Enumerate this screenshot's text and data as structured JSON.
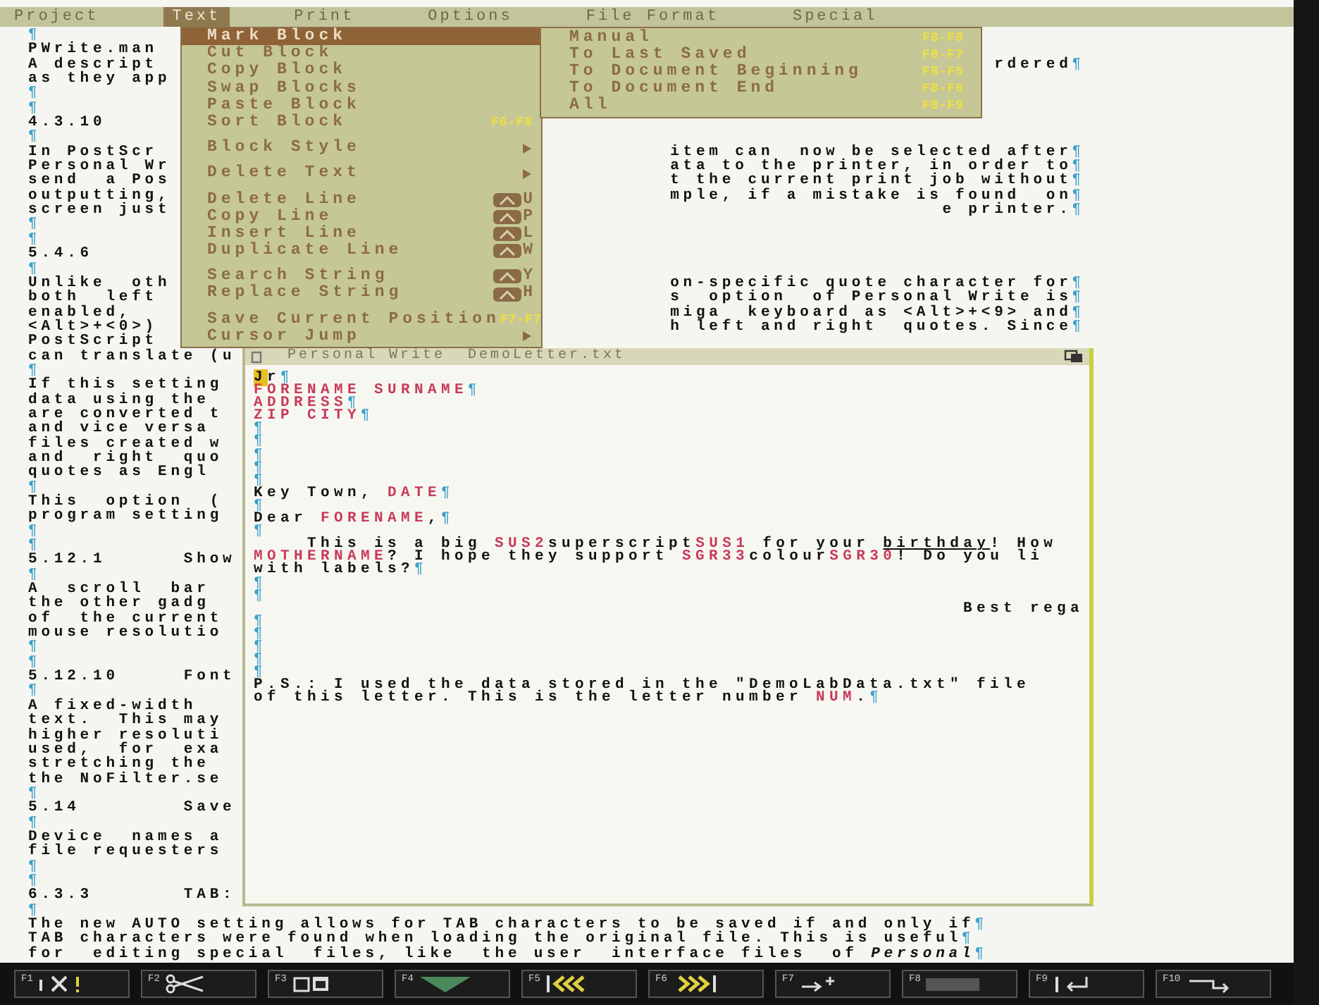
{
  "menubar": [
    {
      "label": "Project",
      "selected": false
    },
    {
      "label": "Text",
      "selected": true
    },
    {
      "label": "Print",
      "selected": false
    },
    {
      "label": "Options",
      "selected": false
    },
    {
      "label": "File Format",
      "selected": false
    },
    {
      "label": "Special",
      "selected": false
    }
  ],
  "document": {
    "lines": [
      {
        "left": [
          {
            "kind": "mark",
            "text": "¶"
          }
        ]
      },
      {
        "left": [
          {
            "kind": "plain",
            "text": "PWrite.man"
          }
        ]
      },
      {
        "left": [
          {
            "kind": "plain",
            "text": "A descript"
          }
        ],
        "right": [
          {
            "kind": "plain",
            "text": "rdered"
          },
          {
            "kind": "mark",
            "text": "¶"
          }
        ]
      },
      {
        "left": [
          {
            "kind": "plain",
            "text": "as they app"
          }
        ]
      },
      {
        "left": [
          {
            "kind": "mark",
            "text": "¶"
          }
        ]
      },
      {
        "left": [
          {
            "kind": "mark",
            "text": "¶"
          }
        ]
      },
      {
        "left": [
          {
            "kind": "plain",
            "text": "4.3.10"
          }
        ]
      },
      {
        "left": [
          {
            "kind": "mark",
            "text": "¶"
          }
        ]
      },
      {
        "left": [
          {
            "kind": "plain",
            "text": "In PostScr"
          }
        ],
        "right": [
          {
            "kind": "plain",
            "text": "item can  now be selected after"
          },
          {
            "kind": "mark",
            "text": "¶"
          }
        ]
      },
      {
        "left": [
          {
            "kind": "plain",
            "text": "Personal Wr"
          }
        ],
        "right": [
          {
            "kind": "plain",
            "text": "ata to the printer, in order to"
          },
          {
            "kind": "mark",
            "text": "¶"
          }
        ]
      },
      {
        "left": [
          {
            "kind": "plain",
            "text": "send  a Pos"
          }
        ],
        "right": [
          {
            "kind": "plain",
            "text": "t the current print job without"
          },
          {
            "kind": "mark",
            "text": "¶"
          }
        ]
      },
      {
        "left": [
          {
            "kind": "plain",
            "text": "outputting,"
          }
        ],
        "right": [
          {
            "kind": "plain",
            "text": "mple, if a mistake is found  on"
          },
          {
            "kind": "mark",
            "text": "¶"
          }
        ]
      },
      {
        "left": [
          {
            "kind": "plain",
            "text": "screen just"
          }
        ],
        "right": [
          {
            "kind": "plain",
            "text": "e printer."
          },
          {
            "kind": "mark",
            "text": "¶"
          }
        ]
      },
      {
        "left": [
          {
            "kind": "mark",
            "text": "¶"
          }
        ]
      },
      {
        "left": [
          {
            "kind": "mark",
            "text": "¶"
          }
        ]
      },
      {
        "left": [
          {
            "kind": "plain",
            "text": "5.4.6"
          }
        ]
      },
      {
        "left": [
          {
            "kind": "mark",
            "text": "¶"
          }
        ]
      },
      {
        "left": [
          {
            "kind": "plain",
            "text": "Unlike  oth"
          }
        ],
        "right": [
          {
            "kind": "plain",
            "text": "on-specific quote character for"
          },
          {
            "kind": "mark",
            "text": "¶"
          }
        ]
      },
      {
        "left": [
          {
            "kind": "plain",
            "text": "both  left"
          }
        ],
        "right": [
          {
            "kind": "plain",
            "text": "s  option  of Personal Write is"
          },
          {
            "kind": "mark",
            "text": "¶"
          }
        ]
      },
      {
        "left": [
          {
            "kind": "plain",
            "text": "enabled,"
          }
        ],
        "right": [
          {
            "kind": "plain",
            "text": "miga  keyboard as <Alt>+<9> and"
          },
          {
            "kind": "mark",
            "text": "¶"
          }
        ]
      },
      {
        "left": [
          {
            "kind": "plain",
            "text": "<Alt>+<0>)"
          }
        ],
        "right": [
          {
            "kind": "plain",
            "text": "h left and right  quotes. Since"
          },
          {
            "kind": "mark",
            "text": "¶"
          }
        ]
      },
      {
        "left": [
          {
            "kind": "plain",
            "text": "PostScript"
          }
        ]
      },
      {
        "left": [
          {
            "kind": "plain",
            "text": "can translate (u"
          }
        ]
      },
      {
        "left": [
          {
            "kind": "mark",
            "text": "¶"
          }
        ]
      },
      {
        "left": [
          {
            "kind": "plain",
            "text": "If this setting"
          }
        ]
      },
      {
        "left": [
          {
            "kind": "plain",
            "text": "data using the"
          }
        ]
      },
      {
        "left": [
          {
            "kind": "plain",
            "text": "are converted t"
          }
        ]
      },
      {
        "left": [
          {
            "kind": "plain",
            "text": "and vice versa"
          }
        ]
      },
      {
        "left": [
          {
            "kind": "plain",
            "text": "files created w"
          }
        ]
      },
      {
        "left": [
          {
            "kind": "plain",
            "text": "and  right  quo"
          }
        ]
      },
      {
        "left": [
          {
            "kind": "plain",
            "text": "quotes as Engl"
          }
        ]
      },
      {
        "left": [
          {
            "kind": "mark",
            "text": "¶"
          }
        ]
      },
      {
        "left": [
          {
            "kind": "plain",
            "text": "This  option  ("
          }
        ]
      },
      {
        "left": [
          {
            "kind": "plain",
            "text": "program setting"
          }
        ]
      },
      {
        "left": [
          {
            "kind": "mark",
            "text": "¶"
          }
        ]
      },
      {
        "left": [
          {
            "kind": "mark",
            "text": "¶"
          }
        ]
      },
      {
        "left": [
          {
            "kind": "plain",
            "text": "5.12.1      Show"
          }
        ]
      },
      {
        "left": [
          {
            "kind": "mark",
            "text": "¶"
          }
        ]
      },
      {
        "left": [
          {
            "kind": "plain",
            "text": "A  scroll  bar"
          }
        ]
      },
      {
        "left": [
          {
            "kind": "plain",
            "text": "the other gadg"
          }
        ]
      },
      {
        "left": [
          {
            "kind": "plain",
            "text": "of  the current"
          }
        ]
      },
      {
        "left": [
          {
            "kind": "plain",
            "text": "mouse resolutio"
          }
        ]
      },
      {
        "left": [
          {
            "kind": "mark",
            "text": "¶"
          }
        ]
      },
      {
        "left": [
          {
            "kind": "mark",
            "text": "¶"
          }
        ]
      },
      {
        "left": [
          {
            "kind": "plain",
            "text": "5.12.10     Font"
          }
        ]
      },
      {
        "left": [
          {
            "kind": "mark",
            "text": "¶"
          }
        ]
      },
      {
        "left": [
          {
            "kind": "plain",
            "text": "A fixed-width"
          }
        ]
      },
      {
        "left": [
          {
            "kind": "plain",
            "text": "text.  This may"
          }
        ]
      },
      {
        "left": [
          {
            "kind": "plain",
            "text": "higher resoluti"
          }
        ]
      },
      {
        "left": [
          {
            "kind": "plain",
            "text": "used,  for  exa"
          }
        ]
      },
      {
        "left": [
          {
            "kind": "plain",
            "text": "stretching the"
          }
        ]
      },
      {
        "left": [
          {
            "kind": "plain",
            "text": "the NoFilter.se"
          }
        ]
      },
      {
        "left": [
          {
            "kind": "mark",
            "text": "¶"
          }
        ]
      },
      {
        "left": [
          {
            "kind": "plain",
            "text": "5.14        Save"
          }
        ]
      },
      {
        "left": [
          {
            "kind": "mark",
            "text": "¶"
          }
        ]
      },
      {
        "left": [
          {
            "kind": "plain",
            "text": "Device  names a"
          }
        ]
      },
      {
        "left": [
          {
            "kind": "plain",
            "text": "file requesters"
          }
        ]
      },
      {
        "left": [
          {
            "kind": "mark",
            "text": "¶"
          }
        ]
      },
      {
        "left": [
          {
            "kind": "mark",
            "text": "¶"
          }
        ]
      },
      {
        "left": [
          {
            "kind": "plain",
            "text": "6.3.3       TAB:"
          }
        ]
      },
      {
        "left": [
          {
            "kind": "mark",
            "text": "¶"
          }
        ]
      },
      {
        "left": [
          {
            "kind": "plain",
            "text": "The new AUTO setting allows for TAB characters to be saved if and only if"
          },
          {
            "kind": "mark",
            "text": "¶"
          }
        ]
      },
      {
        "left": [
          {
            "kind": "plain",
            "text": "TAB characters were found when loading the original file. This is useful"
          },
          {
            "kind": "mark",
            "text": "¶"
          }
        ]
      },
      {
        "left": [
          {
            "kind": "plain",
            "text": "for  editing special  files, like  the user  interface files  of "
          },
          {
            "kind": "italic",
            "text": "Personal"
          },
          {
            "kind": "mark",
            "text": "¶"
          }
        ]
      }
    ]
  },
  "menu": {
    "groups": [
      {
        "items": [
          {
            "label": "Mark Block",
            "selected": true
          },
          {
            "label": "Cut Block",
            "selected": false
          },
          {
            "label": "Copy Block",
            "selected": false
          },
          {
            "label": "Swap Blocks",
            "selected": false
          },
          {
            "label": "Paste Block",
            "selected": false
          },
          {
            "label": "Sort Block",
            "selected": false,
            "shortcut": {
              "kind": "fkey",
              "text": "F6-F8"
            }
          }
        ]
      },
      {
        "items": [
          {
            "label": "Block Style",
            "selected": false,
            "shortcut": {
              "kind": "submenu"
            }
          }
        ]
      },
      {
        "items": [
          {
            "label": "Delete Text",
            "selected": false,
            "shortcut": {
              "kind": "submenu"
            }
          }
        ]
      },
      {
        "items": [
          {
            "label": "Delete Line",
            "selected": false,
            "shortcut": {
              "kind": "amiga",
              "text": "U"
            }
          },
          {
            "label": "Copy Line",
            "selected": false,
            "shortcut": {
              "kind": "amiga",
              "text": "P"
            }
          },
          {
            "label": "Insert Line",
            "selected": false,
            "shortcut": {
              "kind": "amiga",
              "text": "L"
            }
          },
          {
            "label": "Duplicate Line",
            "selected": false,
            "shortcut": {
              "kind": "amiga",
              "text": "W"
            }
          }
        ]
      },
      {
        "items": [
          {
            "label": "Search String",
            "selected": false,
            "shortcut": {
              "kind": "amiga",
              "text": "Y"
            }
          },
          {
            "label": "Replace String",
            "selected": false,
            "shortcut": {
              "kind": "amiga",
              "text": "H"
            }
          }
        ]
      },
      {
        "items": [
          {
            "label": "Save Current Position",
            "selected": false,
            "shortcut": {
              "kind": "fkey",
              "text": "F7-F7"
            }
          },
          {
            "label": "Cursor Jump",
            "selected": false,
            "shortcut": {
              "kind": "submenu"
            }
          }
        ]
      }
    ]
  },
  "submenu": {
    "items": [
      {
        "label": "Manual",
        "shortcut": "F8-F8"
      },
      {
        "label": "To Last Saved",
        "shortcut": "F8-F7"
      },
      {
        "label": "To Document Beginning",
        "shortcut": "F8-F5"
      },
      {
        "label": "To Document End",
        "shortcut": "F8-F6"
      },
      {
        "label": "All",
        "shortcut": "F8-F9"
      }
    ]
  },
  "window": {
    "title": "Personal Write  DemoLetter.txt",
    "lines": [
      {
        "segments": [
          {
            "kind": "cursor",
            "text": "J"
          },
          {
            "kind": "plain",
            "text": "r"
          },
          {
            "kind": "mark",
            "text": "¶"
          }
        ]
      },
      {
        "segments": [
          {
            "kind": "field",
            "text": "FORENAME SURNAME"
          },
          {
            "kind": "mark",
            "text": "¶"
          }
        ]
      },
      {
        "segments": [
          {
            "kind": "field",
            "text": "ADDRESS"
          },
          {
            "kind": "mark",
            "text": "¶"
          }
        ]
      },
      {
        "segments": [
          {
            "kind": "field",
            "text": "ZIP CITY"
          },
          {
            "kind": "mark",
            "text": "¶"
          }
        ]
      },
      {
        "segments": [
          {
            "kind": "mark",
            "text": "¶"
          }
        ]
      },
      {
        "segments": [
          {
            "kind": "mark",
            "text": "¶"
          }
        ]
      },
      {
        "segments": [
          {
            "kind": "mark",
            "text": "¶"
          }
        ]
      },
      {
        "segments": [
          {
            "kind": "mark",
            "text": "¶"
          }
        ]
      },
      {
        "segments": [
          {
            "kind": "mark",
            "text": "¶"
          }
        ]
      },
      {
        "segments": [
          {
            "kind": "plain",
            "text": "Key Town, "
          },
          {
            "kind": "field",
            "text": "DATE"
          },
          {
            "kind": "mark",
            "text": "¶"
          }
        ]
      },
      {
        "segments": [
          {
            "kind": "mark",
            "text": "¶"
          }
        ]
      },
      {
        "segments": [
          {
            "kind": "plain",
            "text": "Dear "
          },
          {
            "kind": "field",
            "text": "FORENAME"
          },
          {
            "kind": "plain",
            "text": ","
          },
          {
            "kind": "mark",
            "text": "¶"
          }
        ]
      },
      {
        "segments": [
          {
            "kind": "mark",
            "text": "¶"
          }
        ]
      },
      {
        "segments": [
          {
            "kind": "plain",
            "text": "    This is a big "
          },
          {
            "kind": "field",
            "text": "SUS2"
          },
          {
            "kind": "plain",
            "text": "superscript"
          },
          {
            "kind": "field",
            "text": "SUS1"
          },
          {
            "kind": "plain",
            "text": " for your "
          },
          {
            "kind": "emphasis",
            "text": "birthday"
          },
          {
            "kind": "plain",
            "text": "! How"
          }
        ]
      },
      {
        "segments": [
          {
            "kind": "field",
            "text": "MOTHERNAME"
          },
          {
            "kind": "plain",
            "text": "? I hope they support "
          },
          {
            "kind": "field",
            "text": "SGR33"
          },
          {
            "kind": "plain",
            "text": "colour"
          },
          {
            "kind": "field",
            "text": "SGR30"
          },
          {
            "kind": "plain",
            "text": "! Do you li"
          }
        ]
      },
      {
        "segments": [
          {
            "kind": "plain",
            "text": "with labels?"
          },
          {
            "kind": "mark",
            "text": "¶"
          }
        ]
      },
      {
        "segments": [
          {
            "kind": "mark",
            "text": "¶"
          }
        ]
      },
      {
        "segments": [
          {
            "kind": "mark",
            "text": "¶"
          }
        ]
      },
      {
        "kind": "closing",
        "segments": [
          {
            "kind": "plain",
            "text": "Best rega"
          }
        ]
      },
      {
        "segments": [
          {
            "kind": "mark",
            "text": "¶"
          }
        ]
      },
      {
        "segments": [
          {
            "kind": "mark",
            "text": "¶"
          }
        ]
      },
      {
        "segments": [
          {
            "kind": "mark",
            "text": "¶"
          }
        ]
      },
      {
        "segments": [
          {
            "kind": "mark",
            "text": "¶"
          }
        ]
      },
      {
        "segments": [
          {
            "kind": "mark",
            "text": "¶"
          }
        ]
      },
      {
        "segments": [
          {
            "kind": "plain",
            "text": "P.S.: I used the data stored in the \"DemoLabData.txt\" file"
          }
        ]
      },
      {
        "segments": [
          {
            "kind": "plain",
            "text": "of this letter. This is the letter number "
          },
          {
            "kind": "field",
            "text": "NUM"
          },
          {
            "kind": "plain",
            "text": "."
          },
          {
            "kind": "mark",
            "text": "¶"
          }
        ]
      }
    ]
  },
  "function_keys": [
    {
      "label": "F1",
      "kind": "cancel"
    },
    {
      "label": "F2",
      "kind": "scissors"
    },
    {
      "label": "F3",
      "kind": "paste"
    },
    {
      "label": "F4",
      "kind": "down"
    },
    {
      "label": "F5",
      "kind": "rewind"
    },
    {
      "label": "F6",
      "kind": "forward"
    },
    {
      "label": "F7",
      "kind": "insert"
    },
    {
      "label": "F8",
      "kind": "blank"
    },
    {
      "label": "F9",
      "kind": "return"
    },
    {
      "label": "F10",
      "kind": "wrap"
    }
  ]
}
